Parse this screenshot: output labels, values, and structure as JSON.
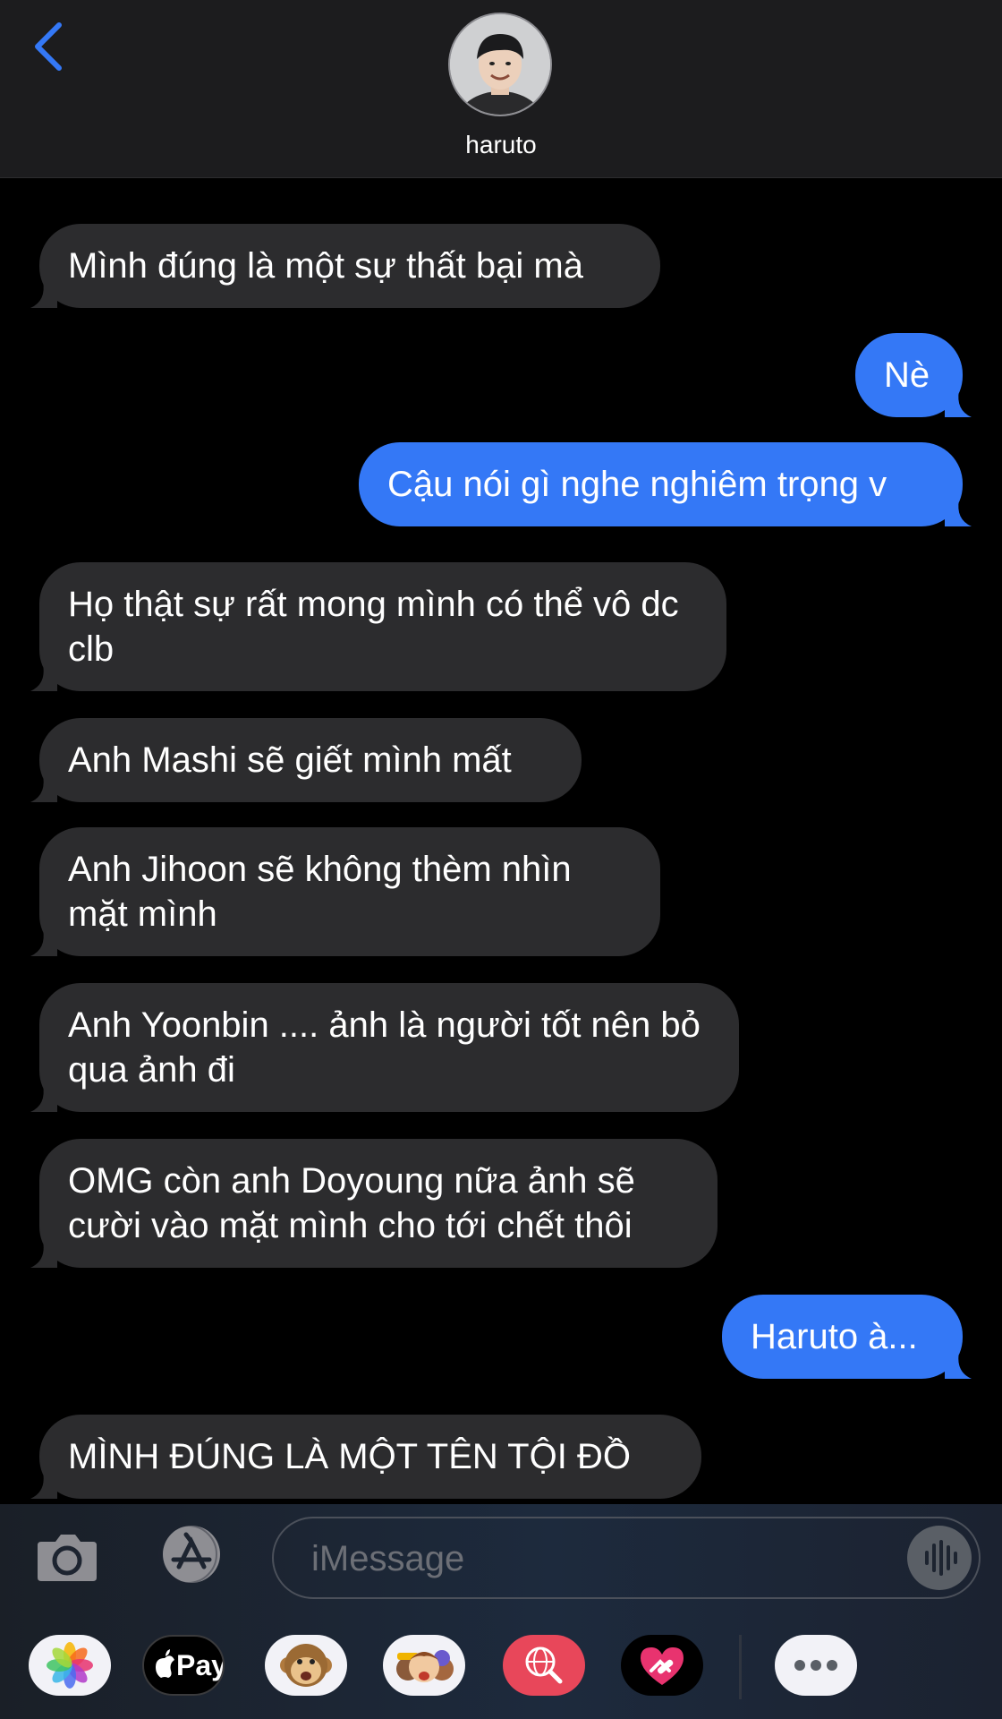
{
  "header": {
    "contact_name": "haruto"
  },
  "messages": [
    {
      "side": "recv",
      "text": "Mình đúng là một sự thất bại mà"
    },
    {
      "side": "sent",
      "text": "Nè"
    },
    {
      "side": "sent",
      "text": "Cậu nói gì nghe nghiêm trọng v"
    },
    {
      "side": "recv",
      "text": "Họ thật sự rất mong mình có thể vô dc clb"
    },
    {
      "side": "recv",
      "text": "Anh Mashi sẽ giết mình mất"
    },
    {
      "side": "recv",
      "text": "Anh Jihoon sẽ không thèm nhìn mặt mình"
    },
    {
      "side": "recv",
      "text": "Anh Yoonbin .... ảnh là người tốt nên bỏ qua ảnh đi"
    },
    {
      "side": "recv",
      "text": "OMG còn anh Doyoung nữa ảnh sẽ cười vào mặt mình cho tới chết thôi"
    },
    {
      "side": "sent",
      "text": "Haruto à..."
    },
    {
      "side": "recv",
      "text": "MÌNH ĐÚNG LÀ MỘT TÊN TỘI ĐỒ"
    }
  ],
  "input": {
    "placeholder": "iMessage"
  },
  "apps": {
    "apple_pay_label": "Pay"
  },
  "colors": {
    "accent": "#3478f6",
    "received_bubble": "#2c2c2e",
    "background": "#000000"
  }
}
